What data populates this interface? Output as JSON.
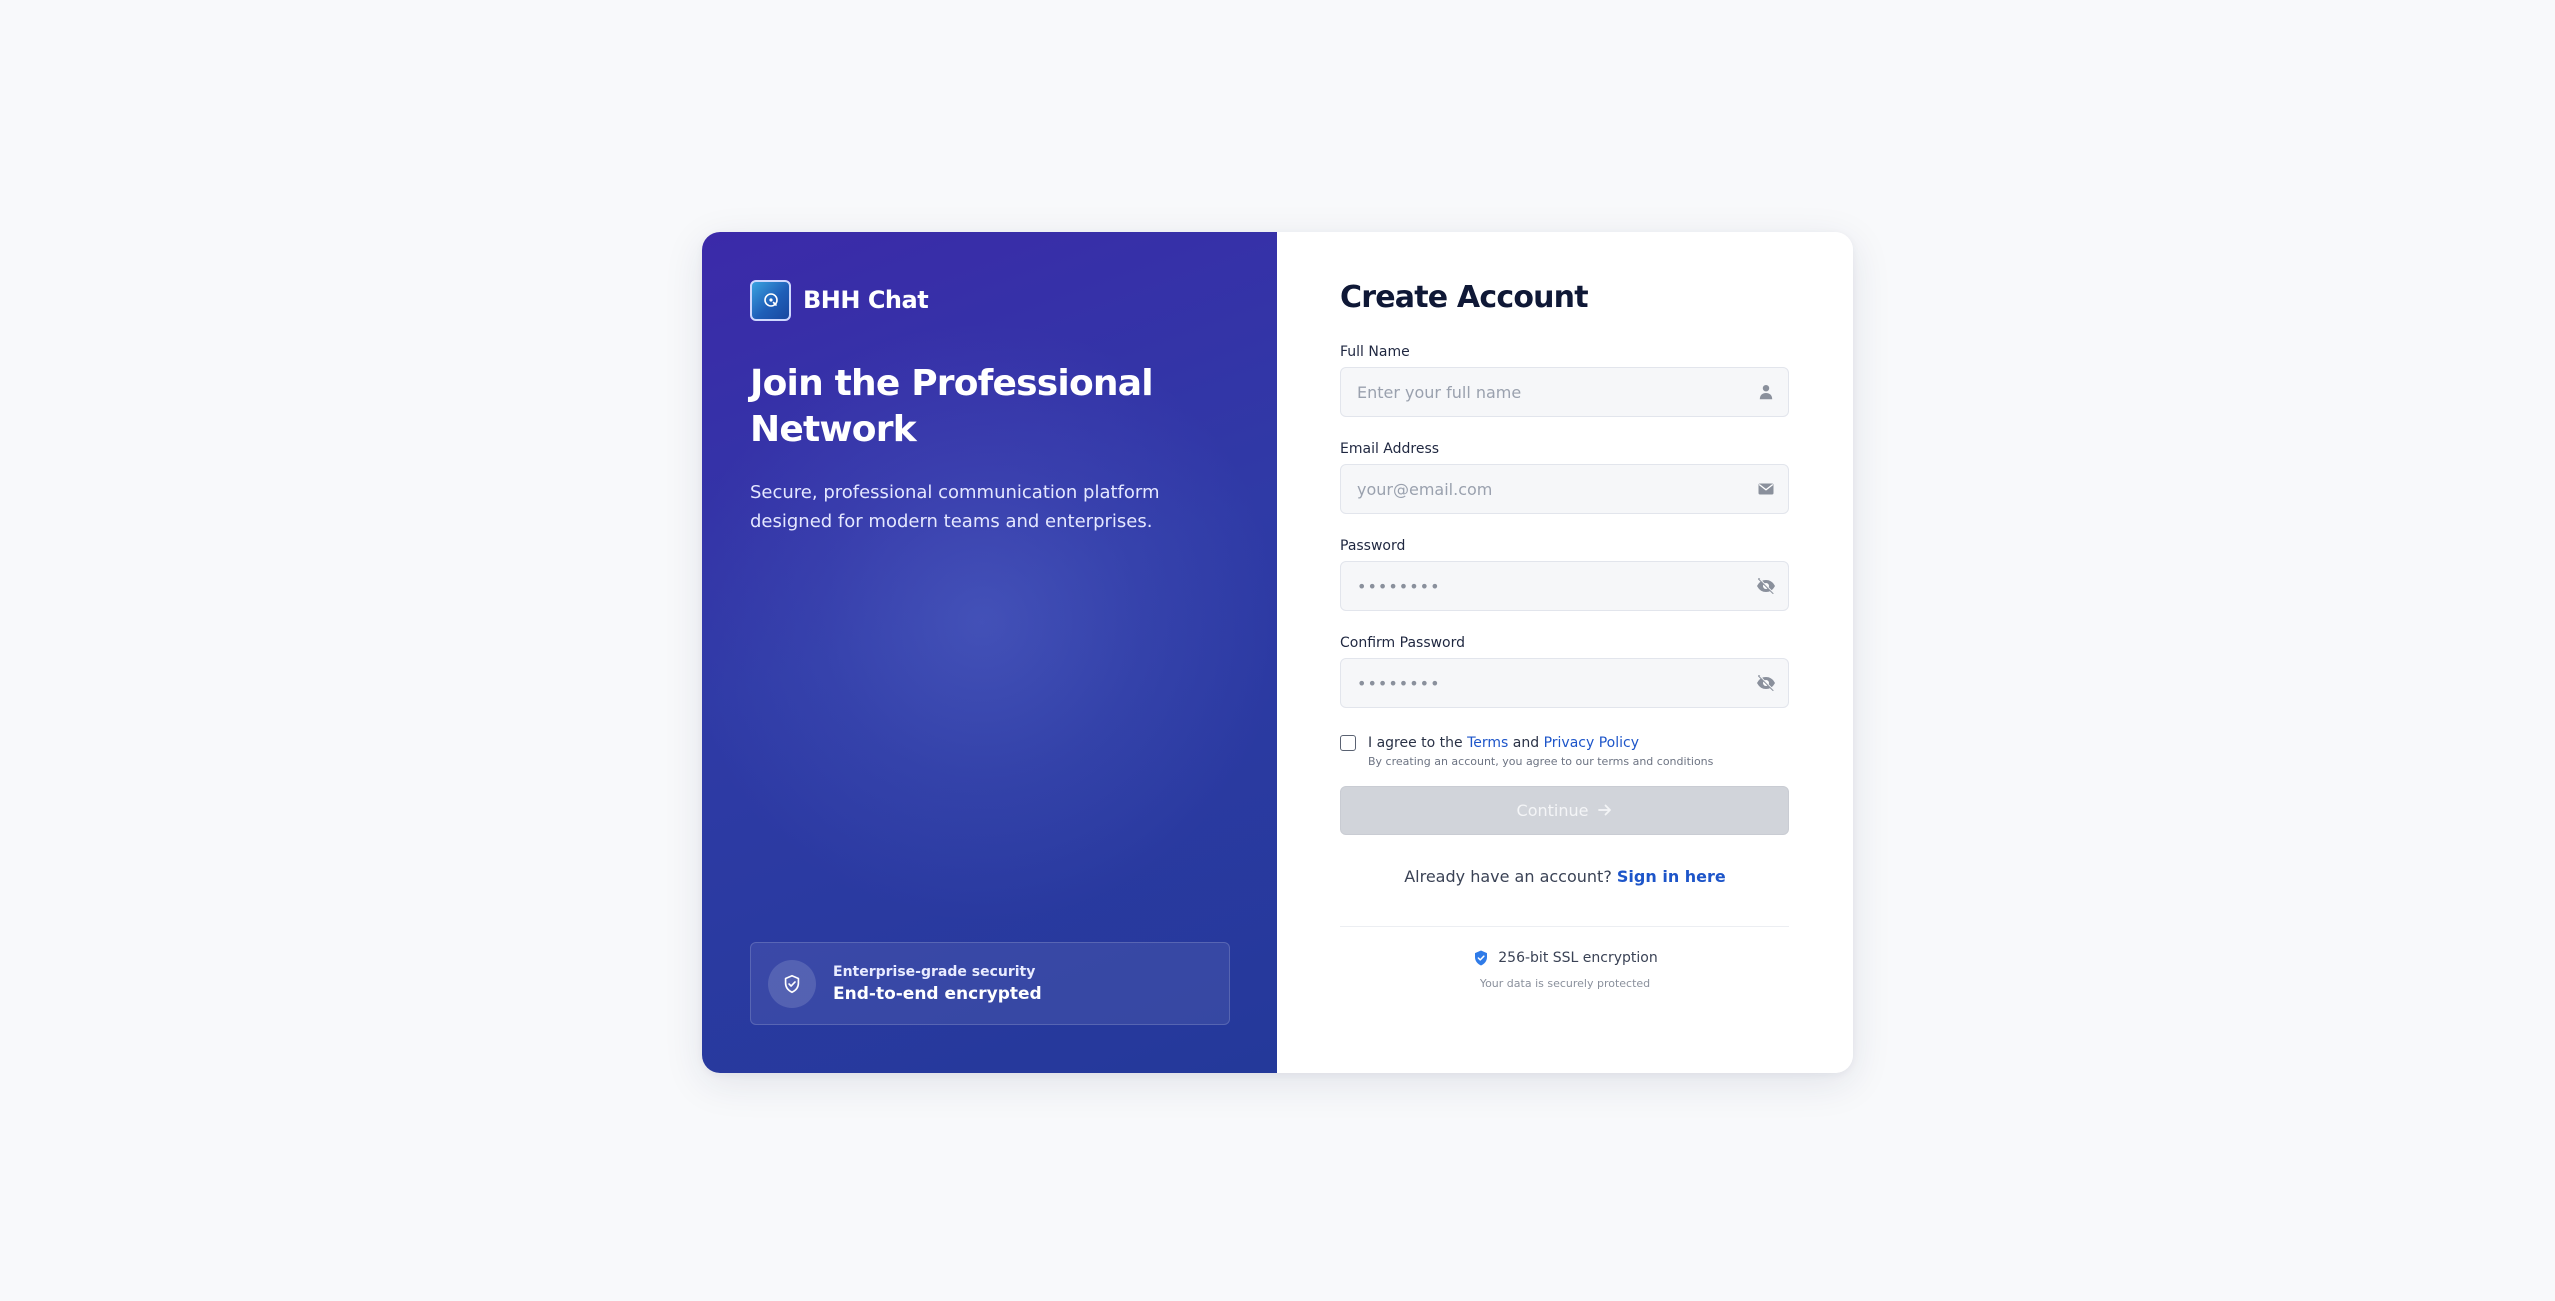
{
  "brand": {
    "name": "BHH Chat"
  },
  "hero": {
    "headline": "Join the Professional Network",
    "tagline": "Secure, professional communication platform designed for modern teams and enterprises."
  },
  "security_badge": {
    "label": "Enterprise-grade security",
    "value": "End-to-end encrypted"
  },
  "form": {
    "title": "Create Account",
    "full_name": {
      "label": "Full Name",
      "placeholder": "Enter your full name",
      "icon": "user-icon"
    },
    "email": {
      "label": "Email Address",
      "placeholder": "your@email.com",
      "icon": "mail-icon"
    },
    "password": {
      "label": "Password",
      "placeholder": "••••••••",
      "icon": "eye-off-icon"
    },
    "confirm_password": {
      "label": "Confirm Password",
      "placeholder": "••••••••",
      "icon": "eye-off-icon"
    },
    "agree": {
      "prefix": "I agree to the",
      "terms": "Terms",
      "and": "and",
      "privacy": "Privacy Policy",
      "note": "By creating an account, you agree to our terms and conditions",
      "checked": false
    },
    "continue_label": "Continue",
    "signin_prompt": "Already have an account?",
    "signin_link": "Sign in here"
  },
  "ssl": {
    "label": "256-bit SSL encryption",
    "note": "Your data is securely protected"
  },
  "colors": {
    "panel_start": "#3b2aa9",
    "panel_end": "#24399a",
    "link": "#1d55c9",
    "button_disabled": "#d1d4da",
    "title": "#0f1836"
  }
}
